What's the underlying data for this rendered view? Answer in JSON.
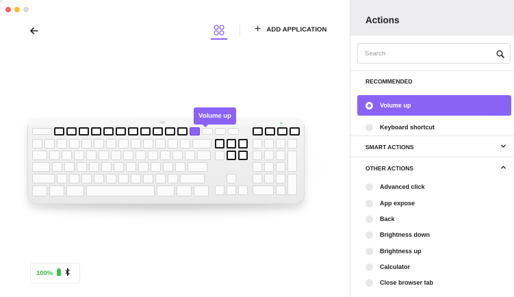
{
  "window": {
    "traffic_colors": [
      "#ff5f57",
      "#febc2e",
      "#d8d8dc"
    ]
  },
  "toolbar": {
    "add_application_label": "ADD APPLICATION"
  },
  "device": {
    "brand_label": "logi",
    "tooltip_label": "Volume up",
    "battery_percent": "100%"
  },
  "panel": {
    "title": "Actions",
    "search_placeholder": "Search",
    "sections": {
      "recommended": "RECOMMENDED",
      "smart_actions": "SMART ACTIONS",
      "other_actions": "OTHER ACTIONS"
    },
    "recommended_items": [
      {
        "label": "Volume up",
        "selected": true
      },
      {
        "label": "Keyboard shortcut",
        "selected": false
      }
    ],
    "other_items": [
      {
        "label": "Advanced click"
      },
      {
        "label": "App expose"
      },
      {
        "label": "Back"
      },
      {
        "label": "Brightness down"
      },
      {
        "label": "Brightness up"
      },
      {
        "label": "Calculator"
      },
      {
        "label": "Close browser tab"
      }
    ]
  },
  "colors": {
    "accent": "#8a63f5",
    "battery_green": "#3cbf4a"
  }
}
